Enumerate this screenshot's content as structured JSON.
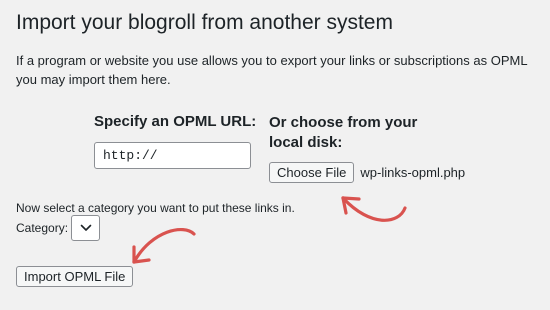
{
  "page": {
    "title": "Import your blogroll from another system",
    "intro": "If a program or website you use allows you to export your links or subscriptions as OPML you may import them here."
  },
  "opml_url": {
    "heading": "Specify an OPML URL:",
    "value": "http://"
  },
  "local_disk": {
    "heading": "Or choose from your local disk:",
    "button_label": "Choose File",
    "file_name": "wp-links-opml.php"
  },
  "category": {
    "instruction": "Now select a category you want to put these links in.",
    "label": "Category:",
    "selected_value": ""
  },
  "submit": {
    "label": "Import OPML File"
  },
  "annotations": {
    "arrow_color": "#d9534f"
  },
  "icons": {
    "select_chevron": "chevron-down-icon",
    "annotation_arrows": "curved-arrow-icon"
  }
}
